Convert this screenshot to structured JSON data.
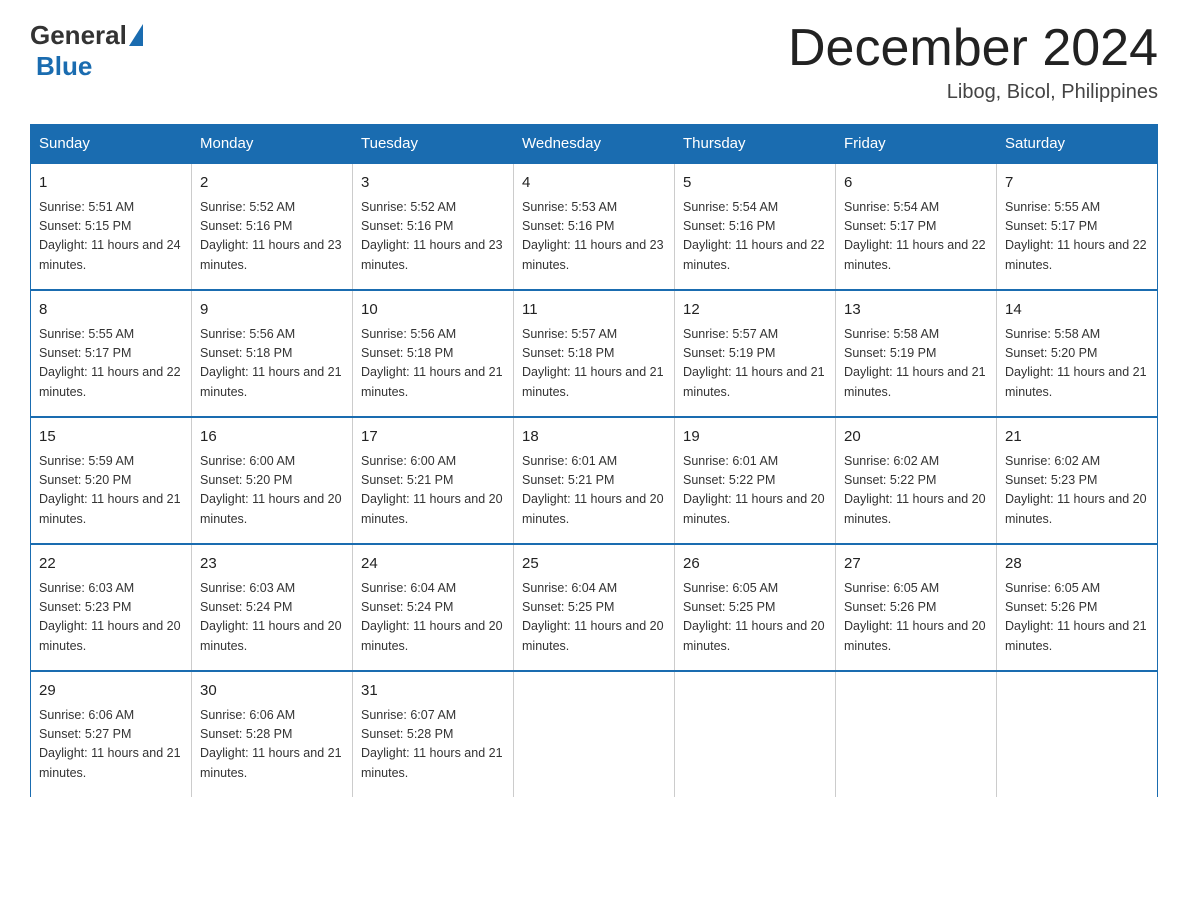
{
  "header": {
    "logo_general": "General",
    "logo_blue": "Blue",
    "title": "December 2024",
    "subtitle": "Libog, Bicol, Philippines"
  },
  "days_of_week": [
    "Sunday",
    "Monday",
    "Tuesday",
    "Wednesday",
    "Thursday",
    "Friday",
    "Saturday"
  ],
  "weeks": [
    [
      {
        "day": "1",
        "sunrise": "5:51 AM",
        "sunset": "5:15 PM",
        "daylight": "11 hours and 24 minutes."
      },
      {
        "day": "2",
        "sunrise": "5:52 AM",
        "sunset": "5:16 PM",
        "daylight": "11 hours and 23 minutes."
      },
      {
        "day": "3",
        "sunrise": "5:52 AM",
        "sunset": "5:16 PM",
        "daylight": "11 hours and 23 minutes."
      },
      {
        "day": "4",
        "sunrise": "5:53 AM",
        "sunset": "5:16 PM",
        "daylight": "11 hours and 23 minutes."
      },
      {
        "day": "5",
        "sunrise": "5:54 AM",
        "sunset": "5:16 PM",
        "daylight": "11 hours and 22 minutes."
      },
      {
        "day": "6",
        "sunrise": "5:54 AM",
        "sunset": "5:17 PM",
        "daylight": "11 hours and 22 minutes."
      },
      {
        "day": "7",
        "sunrise": "5:55 AM",
        "sunset": "5:17 PM",
        "daylight": "11 hours and 22 minutes."
      }
    ],
    [
      {
        "day": "8",
        "sunrise": "5:55 AM",
        "sunset": "5:17 PM",
        "daylight": "11 hours and 22 minutes."
      },
      {
        "day": "9",
        "sunrise": "5:56 AM",
        "sunset": "5:18 PM",
        "daylight": "11 hours and 21 minutes."
      },
      {
        "day": "10",
        "sunrise": "5:56 AM",
        "sunset": "5:18 PM",
        "daylight": "11 hours and 21 minutes."
      },
      {
        "day": "11",
        "sunrise": "5:57 AM",
        "sunset": "5:18 PM",
        "daylight": "11 hours and 21 minutes."
      },
      {
        "day": "12",
        "sunrise": "5:57 AM",
        "sunset": "5:19 PM",
        "daylight": "11 hours and 21 minutes."
      },
      {
        "day": "13",
        "sunrise": "5:58 AM",
        "sunset": "5:19 PM",
        "daylight": "11 hours and 21 minutes."
      },
      {
        "day": "14",
        "sunrise": "5:58 AM",
        "sunset": "5:20 PM",
        "daylight": "11 hours and 21 minutes."
      }
    ],
    [
      {
        "day": "15",
        "sunrise": "5:59 AM",
        "sunset": "5:20 PM",
        "daylight": "11 hours and 21 minutes."
      },
      {
        "day": "16",
        "sunrise": "6:00 AM",
        "sunset": "5:20 PM",
        "daylight": "11 hours and 20 minutes."
      },
      {
        "day": "17",
        "sunrise": "6:00 AM",
        "sunset": "5:21 PM",
        "daylight": "11 hours and 20 minutes."
      },
      {
        "day": "18",
        "sunrise": "6:01 AM",
        "sunset": "5:21 PM",
        "daylight": "11 hours and 20 minutes."
      },
      {
        "day": "19",
        "sunrise": "6:01 AM",
        "sunset": "5:22 PM",
        "daylight": "11 hours and 20 minutes."
      },
      {
        "day": "20",
        "sunrise": "6:02 AM",
        "sunset": "5:22 PM",
        "daylight": "11 hours and 20 minutes."
      },
      {
        "day": "21",
        "sunrise": "6:02 AM",
        "sunset": "5:23 PM",
        "daylight": "11 hours and 20 minutes."
      }
    ],
    [
      {
        "day": "22",
        "sunrise": "6:03 AM",
        "sunset": "5:23 PM",
        "daylight": "11 hours and 20 minutes."
      },
      {
        "day": "23",
        "sunrise": "6:03 AM",
        "sunset": "5:24 PM",
        "daylight": "11 hours and 20 minutes."
      },
      {
        "day": "24",
        "sunrise": "6:04 AM",
        "sunset": "5:24 PM",
        "daylight": "11 hours and 20 minutes."
      },
      {
        "day": "25",
        "sunrise": "6:04 AM",
        "sunset": "5:25 PM",
        "daylight": "11 hours and 20 minutes."
      },
      {
        "day": "26",
        "sunrise": "6:05 AM",
        "sunset": "5:25 PM",
        "daylight": "11 hours and 20 minutes."
      },
      {
        "day": "27",
        "sunrise": "6:05 AM",
        "sunset": "5:26 PM",
        "daylight": "11 hours and 20 minutes."
      },
      {
        "day": "28",
        "sunrise": "6:05 AM",
        "sunset": "5:26 PM",
        "daylight": "11 hours and 21 minutes."
      }
    ],
    [
      {
        "day": "29",
        "sunrise": "6:06 AM",
        "sunset": "5:27 PM",
        "daylight": "11 hours and 21 minutes."
      },
      {
        "day": "30",
        "sunrise": "6:06 AM",
        "sunset": "5:28 PM",
        "daylight": "11 hours and 21 minutes."
      },
      {
        "day": "31",
        "sunrise": "6:07 AM",
        "sunset": "5:28 PM",
        "daylight": "11 hours and 21 minutes."
      },
      null,
      null,
      null,
      null
    ]
  ],
  "labels": {
    "sunrise_prefix": "Sunrise: ",
    "sunset_prefix": "Sunset: ",
    "daylight_prefix": "Daylight: "
  }
}
